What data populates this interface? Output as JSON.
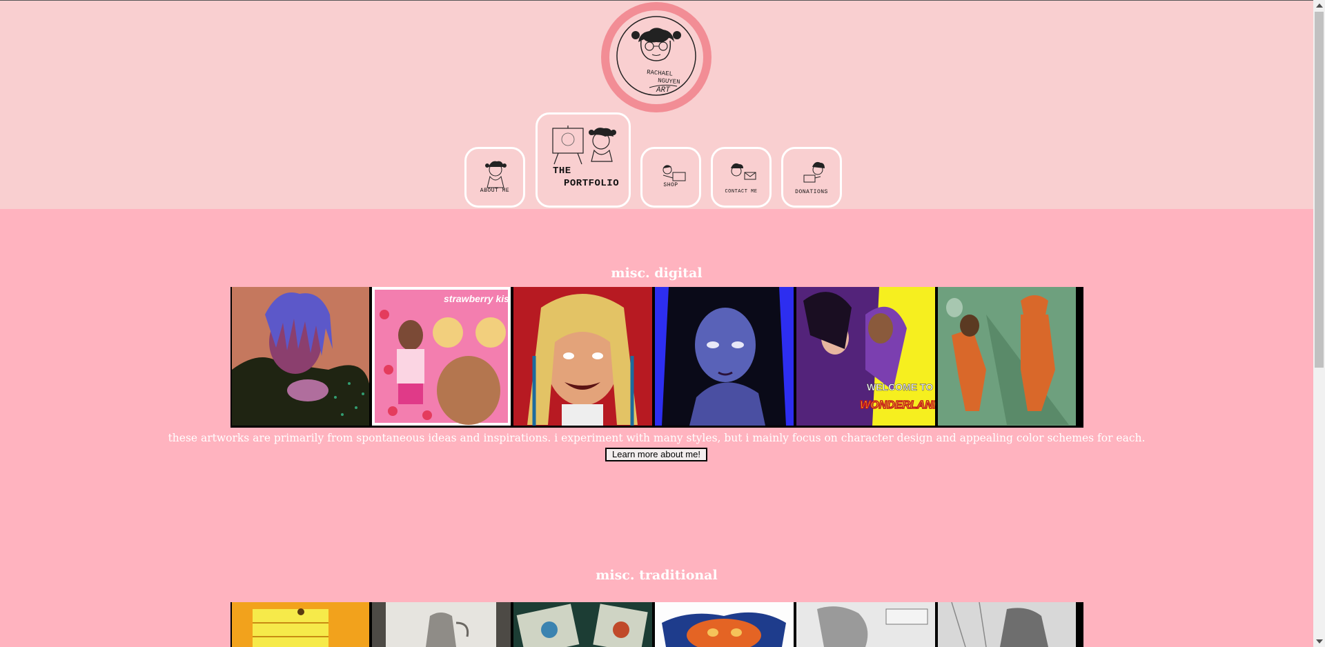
{
  "logo": {
    "text_line1": "RACHAEL",
    "text_line2": "NGUYEN",
    "text_line3": "ART",
    "ring_color": "#f28d95"
  },
  "nav": {
    "about_label": "ABOUT ME",
    "portfolio_label_line1": "THE",
    "portfolio_label_line2": "PORTFOLIO",
    "shop_label": "SHOP",
    "contact_label": "CONTACT ME",
    "donations_label": "DONATIONS"
  },
  "digital": {
    "title": "misc. digital",
    "description": "these artworks are primarily from spontaneous ideas and inspirations. i experiment with many styles, but i mainly focus on character design and appealing color schemes for each.",
    "button_label": "Learn more about me!",
    "tile_texts": {
      "strawberry": "strawberry kiss",
      "welcome_line1": "WELCOME TO",
      "welcome_line2": "WONDERLAND"
    }
  },
  "traditional": {
    "title": "misc. traditional"
  },
  "colors": {
    "header_bg": "#f9cfd0",
    "page_bg": "#ffb3bf",
    "text": "#ffffff"
  }
}
